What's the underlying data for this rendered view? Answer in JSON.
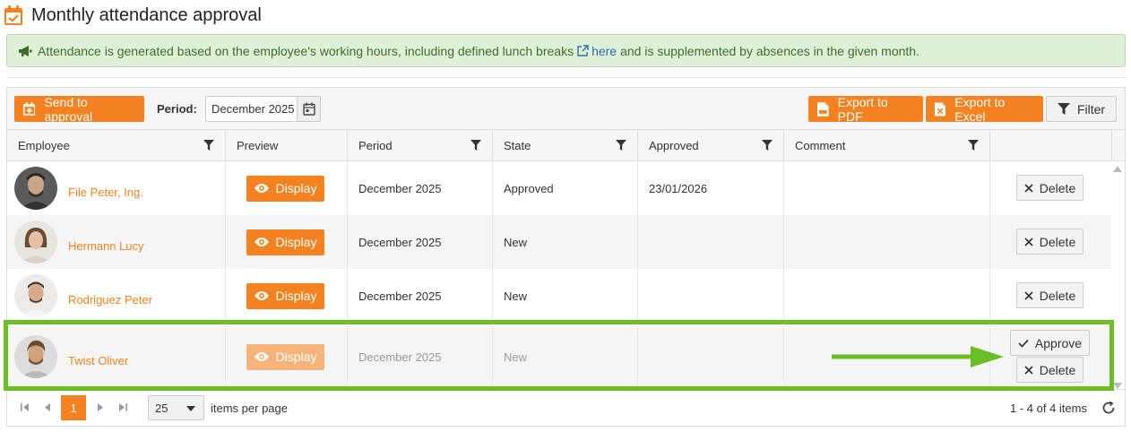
{
  "page": {
    "title": "Monthly attendance approval",
    "title_icon": "calendar-check-icon"
  },
  "info": {
    "text_before": "Attendance is generated based on the employee's working hours, including defined lunch breaks",
    "link_text": "here",
    "text_after": "and is supplemented by absences in the given month.",
    "icon": "megaphone-icon"
  },
  "toolbar": {
    "send_label": "Send to approval",
    "period_label": "Period:",
    "period_value": "December 2025",
    "export_pdf_label": "Export to PDF",
    "export_excel_label": "Export to Excel",
    "filter_label": "Filter"
  },
  "columns": {
    "employee": "Employee",
    "preview": "Preview",
    "period": "Period",
    "state": "State",
    "approved": "Approved",
    "comment": "Comment"
  },
  "rows": [
    {
      "name": "File Peter, Ing.",
      "preview": "Display",
      "period": "December 2025",
      "state": "Approved",
      "approved": "23/01/2026",
      "comment": "",
      "delete": "Delete"
    },
    {
      "name": "Hermann Lucy",
      "preview": "Display",
      "period": "December 2025",
      "state": "New",
      "approved": "",
      "comment": "",
      "delete": "Delete"
    },
    {
      "name": "Rodriguez Peter",
      "preview": "Display",
      "period": "December 2025",
      "state": "New",
      "approved": "",
      "comment": "",
      "delete": "Delete"
    },
    {
      "name": "Twist Oliver",
      "preview": "Display",
      "period": "December 2025",
      "state": "New",
      "approved": "",
      "comment": "",
      "delete": "Delete",
      "approve": "Approve"
    }
  ],
  "pager": {
    "current_page": "1",
    "page_size": "25",
    "items_per_page_label": "items per page",
    "info": "1 - 4 of 4 items"
  },
  "colors": {
    "accent": "#f58220",
    "info_bg": "#dff0d8",
    "highlight": "#6abf27",
    "link": "#2a6db0"
  }
}
